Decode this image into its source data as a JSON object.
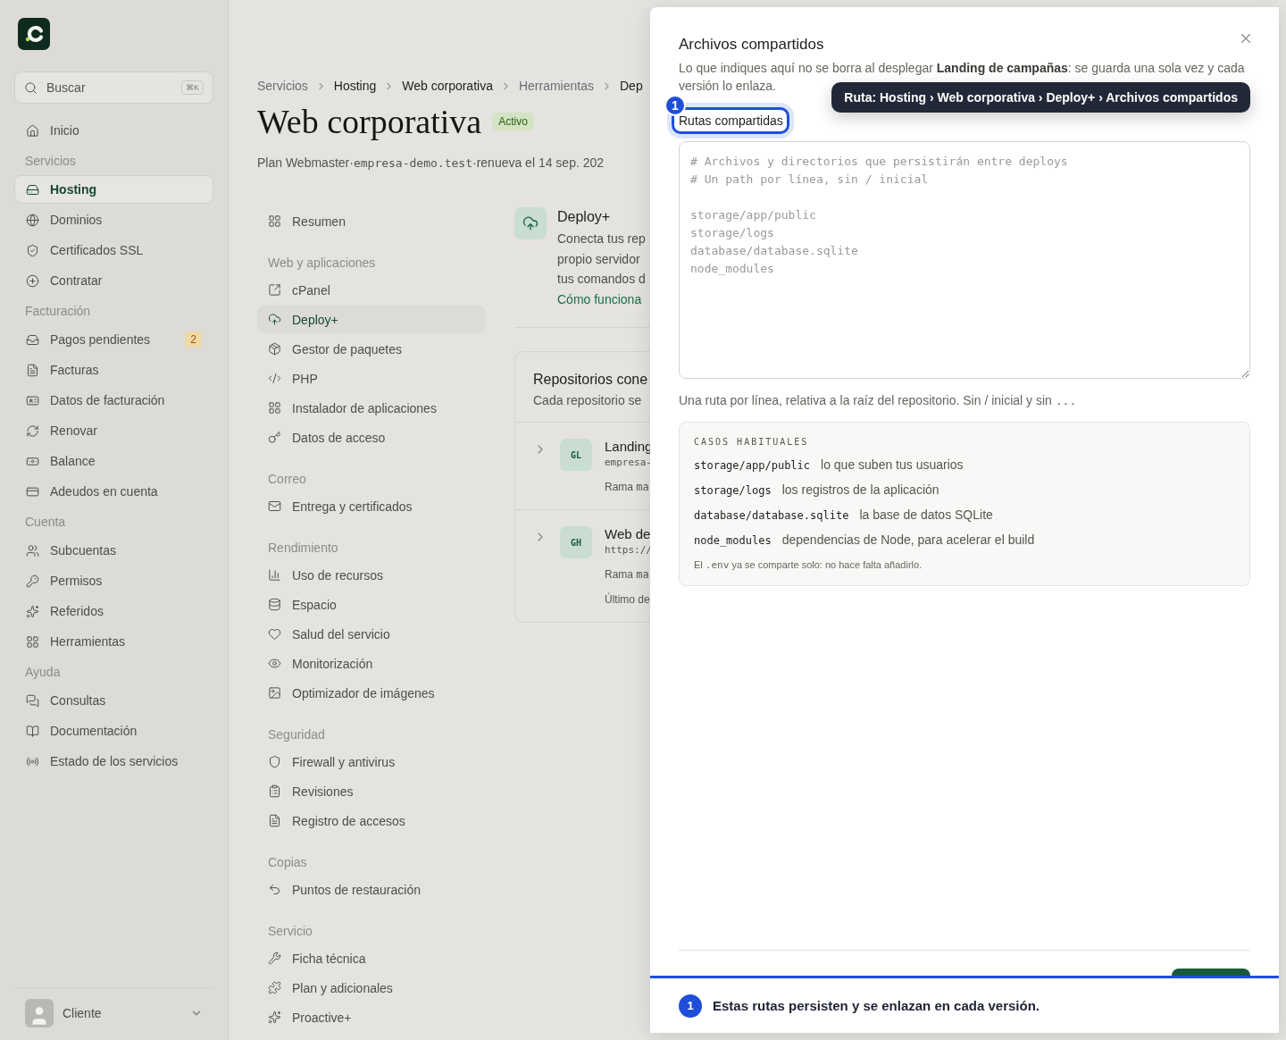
{
  "sidebar": {
    "search": {
      "placeholder": "Buscar",
      "shortcut": "⌘K"
    },
    "items": [
      {
        "kind": "item",
        "label": "Inicio",
        "selected": false
      },
      {
        "kind": "section",
        "label": "Servicios"
      },
      {
        "kind": "item",
        "label": "Hosting",
        "selected": true
      },
      {
        "kind": "item",
        "label": "Dominios",
        "selected": false
      },
      {
        "kind": "item",
        "label": "Certificados SSL",
        "selected": false
      },
      {
        "kind": "item",
        "label": "Contratar",
        "selected": false
      },
      {
        "kind": "section",
        "label": "Facturación"
      },
      {
        "kind": "item",
        "label": "Pagos pendientes",
        "selected": false,
        "badge": "2"
      },
      {
        "kind": "item",
        "label": "Facturas",
        "selected": false
      },
      {
        "kind": "item",
        "label": "Datos de facturación",
        "selected": false
      },
      {
        "kind": "item",
        "label": "Renovar",
        "selected": false
      },
      {
        "kind": "item",
        "label": "Balance",
        "selected": false
      },
      {
        "kind": "item",
        "label": "Adeudos en cuenta",
        "selected": false
      },
      {
        "kind": "section",
        "label": "Cuenta"
      },
      {
        "kind": "item",
        "label": "Subcuentas",
        "selected": false
      },
      {
        "kind": "item",
        "label": "Permisos",
        "selected": false
      },
      {
        "kind": "item",
        "label": "Referidos",
        "selected": false
      },
      {
        "kind": "item",
        "label": "Herramientas",
        "selected": false
      },
      {
        "kind": "section",
        "label": "Ayuda"
      },
      {
        "kind": "item",
        "label": "Consultas",
        "selected": false
      },
      {
        "kind": "item",
        "label": "Documentación",
        "selected": false
      },
      {
        "kind": "item",
        "label": "Estado de los servicios",
        "selected": false
      }
    ],
    "user": {
      "name": "Cliente"
    }
  },
  "breadcrumb": [
    {
      "label": "Servicios",
      "muted": true
    },
    {
      "label": "Hosting",
      "muted": false
    },
    {
      "label": "Web corporativa",
      "muted": false
    },
    {
      "label": "Herramientas",
      "muted": true
    },
    {
      "label": "Dep",
      "muted": false
    }
  ],
  "header": {
    "title": "Web corporativa",
    "status": "Activo",
    "meta": [
      {
        "kind": "text",
        "text": "Plan Webmaster"
      },
      {
        "kind": "sep",
        "text": "·"
      },
      {
        "kind": "code",
        "text": "empresa-demo.test"
      },
      {
        "kind": "sep",
        "text": "·"
      },
      {
        "kind": "text",
        "text": "renueva el 14 sep. 202"
      }
    ]
  },
  "subnav": [
    {
      "kind": "item",
      "label": "Resumen",
      "selected": false
    },
    {
      "kind": "section",
      "label": "Web y aplicaciones"
    },
    {
      "kind": "item",
      "label": "cPanel",
      "selected": false
    },
    {
      "kind": "item",
      "label": "Deploy+",
      "selected": true
    },
    {
      "kind": "item",
      "label": "Gestor de paquetes",
      "selected": false
    },
    {
      "kind": "item",
      "label": "PHP",
      "selected": false
    },
    {
      "kind": "item",
      "label": "Instalador de aplicaciones",
      "selected": false
    },
    {
      "kind": "item",
      "label": "Datos de acceso",
      "selected": false
    },
    {
      "kind": "section",
      "label": "Correo"
    },
    {
      "kind": "item",
      "label": "Entrega y certificados",
      "selected": false
    },
    {
      "kind": "section",
      "label": "Rendimiento"
    },
    {
      "kind": "item",
      "label": "Uso de recursos",
      "selected": false
    },
    {
      "kind": "item",
      "label": "Espacio",
      "selected": false
    },
    {
      "kind": "item",
      "label": "Salud del servicio",
      "selected": false
    },
    {
      "kind": "item",
      "label": "Monitorización",
      "selected": false
    },
    {
      "kind": "item",
      "label": "Optimizador de imágenes",
      "selected": false
    },
    {
      "kind": "section",
      "label": "Seguridad"
    },
    {
      "kind": "item",
      "label": "Firewall y antivirus",
      "selected": false
    },
    {
      "kind": "item",
      "label": "Revisiones",
      "selected": false
    },
    {
      "kind": "item",
      "label": "Registro de accesos",
      "selected": false
    },
    {
      "kind": "section",
      "label": "Copias"
    },
    {
      "kind": "item",
      "label": "Puntos de restauración",
      "selected": false
    },
    {
      "kind": "section",
      "label": "Servicio"
    },
    {
      "kind": "item",
      "label": "Ficha técnica",
      "selected": false
    },
    {
      "kind": "item",
      "label": "Plan y adicionales",
      "selected": false
    },
    {
      "kind": "item",
      "label": "Proactive+",
      "selected": false
    }
  ],
  "deploy": {
    "title": "Deploy+",
    "lines": [
      "Conecta tus rep",
      "propio servidor",
      "tus comandos d"
    ],
    "link": "Cómo funciona"
  },
  "repositories": {
    "title": "Repositorios cone",
    "subtitle": "Cada repositorio se",
    "items": [
      {
        "initials": "GL",
        "name": "Landing",
        "source": "empresa-",
        "branch_label": "Rama",
        "branch": "ma"
      },
      {
        "initials": "GH",
        "name": "Web de",
        "source": "https://",
        "branch_label": "Rama",
        "branch": "ma",
        "last": "Último de"
      }
    ]
  },
  "drawer": {
    "title": "Archivos compartidos",
    "description": "Lo que indiques aquí no se borra al desplegar **Landing de campañas**: se guarda una sola vez y cada versión lo enlaza.",
    "tooltip": "Ruta: Hosting › Web corporativa › Deploy+ › Archivos compartidos",
    "step": "1",
    "field_label": "Rutas compartidas",
    "placeholder": "# Archivos y directorios que persistirán entre deploys\n# Un path por línea, sin / inicial\n\nstorage/app/public\nstorage/logs\ndatabase/database.sqlite\nnode_modules",
    "help": {
      "text": "Una ruta por línea, relativa a la raíz del repositorio. Sin / inicial y sin",
      "code": "..."
    },
    "cases": {
      "heading": "CASOS HABITUALES",
      "rows": [
        {
          "path": "storage/app/public",
          "text": "lo que suben tus usuarios"
        },
        {
          "path": "storage/logs",
          "text": "los registros de la aplicación"
        },
        {
          "path": "database/database.sqlite",
          "text": "la base de datos SQLite"
        },
        {
          "path": "node_modules",
          "text": "dependencias de Node, para acelerar el build"
        }
      ],
      "note": {
        "before": "El",
        "code": ".env",
        "after": "ya se comparte solo: no hace falta añadirlo."
      }
    },
    "tour": {
      "step": "1",
      "text": "Estas rutas persisten y se enlazan en cada versión."
    }
  }
}
